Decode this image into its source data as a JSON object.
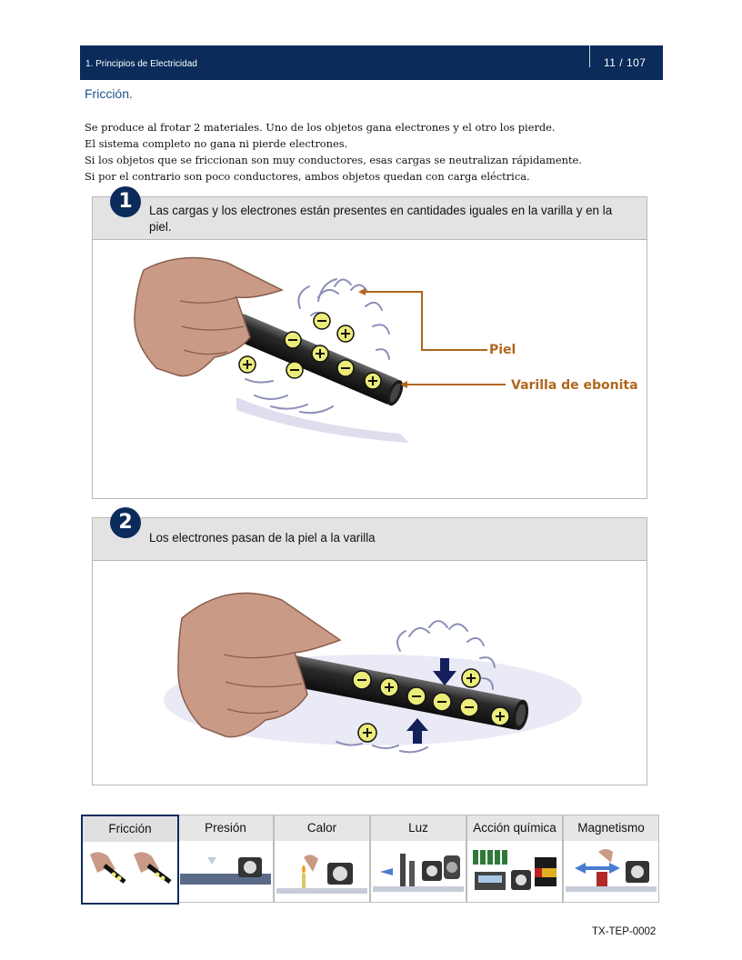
{
  "header": {
    "chapter": "1. Principios de Electricidad",
    "pages": "11 / 107"
  },
  "section": {
    "title": "Fricción."
  },
  "intro": [
    "Se produce al frotar 2 materiales. Uno de los objetos gana electrones y el otro los pierde.",
    "El sistema completo no gana ni pierde electrones.",
    "Si los objetos que se friccionan son muy conductores, esas cargas se neutralizan rápidamente.",
    "Si por el contrario son poco conductores, ambos objetos quedan con carga eléctrica."
  ],
  "steps": [
    {
      "number": "1",
      "caption": "Las cargas y los electrones están presentes en cantidades iguales en la varilla y en la piel.",
      "label_skin": "Piel",
      "label_rod": "Varilla de ebonita"
    },
    {
      "number": "2",
      "caption": "Los electrones pasan de la piel a la varilla"
    }
  ],
  "tabs": [
    {
      "label": "Fricción",
      "active": true
    },
    {
      "label": "Presión",
      "active": false
    },
    {
      "label": "Calor",
      "active": false
    },
    {
      "label": "Luz",
      "active": false
    },
    {
      "label": "Acción química",
      "active": false
    },
    {
      "label": "Magnetismo",
      "active": false
    }
  ],
  "footer": {
    "code": "TX-TEP-0002"
  },
  "colors": {
    "header_bg": "#0b2b5b",
    "title_blue": "#1d4f8e",
    "label_orange": "#b0661e",
    "charge_yellow": "#ecec7a"
  }
}
